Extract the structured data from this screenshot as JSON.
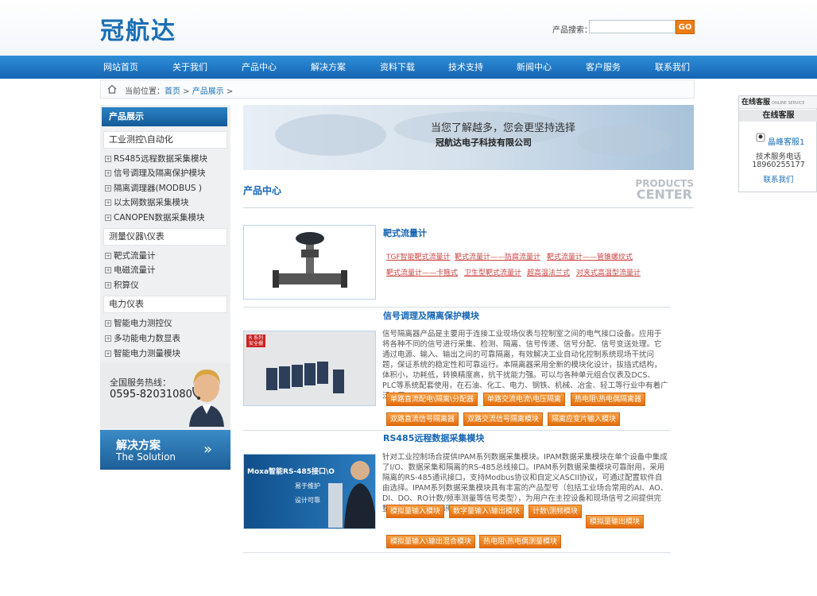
{
  "header": {
    "logo_text": "冠航达",
    "search_label": "产品搜索：",
    "search_value": "",
    "search_go": "GO"
  },
  "nav": {
    "items": [
      "网站首页",
      "关于我们",
      "产品中心",
      "解决方案",
      "资料下载",
      "技术支持",
      "新闻中心",
      "客户服务",
      "联系我们"
    ]
  },
  "breadcrumb": {
    "prefix": "当前位置：",
    "home": "首页",
    "sep1": " > ",
    "current": "产品展示",
    "sep2": " >"
  },
  "sidebar": {
    "title": "产品展示",
    "categories": [
      {
        "name": "工业测控\\自动化",
        "items": [
          "RS485远程数据采集模块",
          "信号调理及隔离保护模块",
          "隔离调理器(MODBUS )",
          "以太网数据采集模块",
          "CANOPEN数据采集模块"
        ]
      },
      {
        "name": "测量仪器\\仪表",
        "items": [
          "靶式流量计",
          "电磁流量计",
          "积算仪"
        ]
      },
      {
        "name": "电力仪表",
        "items": [
          "智能电力测控仪",
          "多功能电力数显表",
          "智能电力测量模块"
        ]
      }
    ],
    "hotline_label": "全国服务热线：",
    "hotline_number": "0595-82031080",
    "solution_title": "解决方案",
    "solution_subtitle": "The Solution"
  },
  "banner": {
    "slogan": "当您了解越多，您会更坚持选择",
    "company": "冠航达电子科技有限公司"
  },
  "section": {
    "title": "产品中心",
    "en_line1": "PRODUCTS",
    "en_line2": "CENTER"
  },
  "products": [
    {
      "title": "靶式流量计",
      "desc": "",
      "links": [
        "TGF智能靶式流量计",
        "靶式流量计——防腐流量计",
        "靶式流量计——管锥螺纹式",
        "靶式流量计——卡箍式",
        "卫生型靶式流量计",
        "超高温法兰式",
        "对夹式高温型流量计"
      ],
      "tags": []
    },
    {
      "title": "信号调理及隔离保护模块",
      "desc": "信号隔离器产品是主要用于连接工业现场仪表与控制室之间的电气接口设备。应用于将各种不同的信号进行采集、检测、隔离、信号传递、信号分配、信号变送处理。它通过电源、输入、输出之间的可靠隔离，有效解决工业自动化控制系统现场干扰问题，保证系统的稳定性和可靠运行。本隔离器采用全新的模块化设计，拔插式结构，体积小，功耗低，转换精度高，抗干扰能力强。可以与各种单元组合仪表及DCS、PLC等系统配套使用，在石油、化工、电力、钢铁、机械、冶金、轻工等行业中有着广泛应用。",
      "thumb_badge": "R 系列 安全栅",
      "links": [],
      "tags": [
        "单路直流配电\\隔离\\分配器",
        "单路交流电流\\电压隔离",
        "热电阻\\热电偶隔离器",
        "双路直流信号隔离器",
        "双路交流信号隔离模块",
        "隔离应变片输入模块"
      ]
    },
    {
      "title": "RS485远程数据采集模块",
      "desc": "针对工业控制场合提供IPAM系列数据采集模块。IPAM数据采集模块在单个设备中集成了I/O、数据采集和隔离的RS-485总线接口。IPAM系列数据采集模块可靠耐用，采用隔离的RS-485通讯接口，支持Modbus协议和自定义ASCII协议，可通过配置软件自由选择。IPAM系列数据采集模块具有丰富的产品型号（包括工业场合常用的AI、AO、DI、DO、RO计数/频率测量等信号类型），为用户在主控设备和现场信号之间提供完整的数据采集和通讯解决方案。",
      "thumb_text1": "Moxa智能RS-485接口\\O",
      "thumb_text2": "易于维护",
      "thumb_text3": "设计可靠",
      "links": [],
      "tags": [
        "模拟量输入模块",
        "数字量输入\\输出模块",
        "计数\\测频模块",
        "模拟量输出模块",
        "模拟量输入\\输出混合模块",
        "热电阻\\热电偶测量模块"
      ]
    }
  ],
  "service": {
    "head": "在线客服",
    "head_en": "ONLINE SERVICE",
    "sub": "在线客服",
    "agent": "晶峰客服1",
    "phone_label": "技术服务电话",
    "phone": "18960255177",
    "contact": "联系我们"
  },
  "colors": {
    "nav_blue": "#1a6fb5",
    "accent_orange": "#ee7d12",
    "link_red": "#cc4444"
  }
}
